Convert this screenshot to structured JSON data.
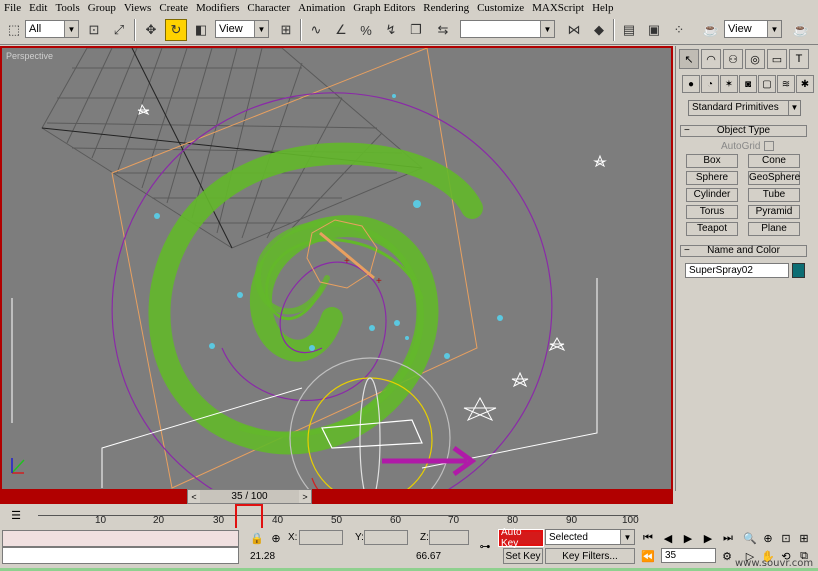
{
  "menu": [
    "File",
    "Edit",
    "Tools",
    "Group",
    "Views",
    "Create",
    "Modifiers",
    "Character",
    "Animation",
    "Graph Editors",
    "Rendering",
    "Customize",
    "MAXScript",
    "Help"
  ],
  "toolbar": {
    "selection_filter": "All",
    "ref_coord": "View",
    "named_selection": "",
    "view_dropdown": "View"
  },
  "viewport": {
    "label": "Perspective"
  },
  "time_slider": {
    "value": "35 / 100",
    "prev": "<",
    "next": ">"
  },
  "trackbar": {
    "ticks": [
      "10",
      "20",
      "30",
      "40",
      "50",
      "60",
      "70",
      "80",
      "90",
      "100"
    ]
  },
  "status": {
    "x_label": "X:",
    "y_label": "Y:",
    "z_label": "Z:",
    "coord_a": "21.28",
    "coord_b": "66.67",
    "auto_key": "Auto Key",
    "set_key": "Set Key",
    "key_mode": "Selected",
    "key_filters": "Key Filters...",
    "current_frame": "35"
  },
  "command_panel": {
    "category": "Standard Primitives",
    "object_type_title": "Object Type",
    "autogrid_label": "AutoGrid",
    "primitives": [
      "Box",
      "Cone",
      "Sphere",
      "GeoSphere",
      "Cylinder",
      "Tube",
      "Torus",
      "Pyramid",
      "Teapot",
      "Plane"
    ],
    "name_color_title": "Name and Color",
    "object_name": "SuperSpray02",
    "object_color": "#0d6d73"
  },
  "watermark": "www.souvr.com"
}
